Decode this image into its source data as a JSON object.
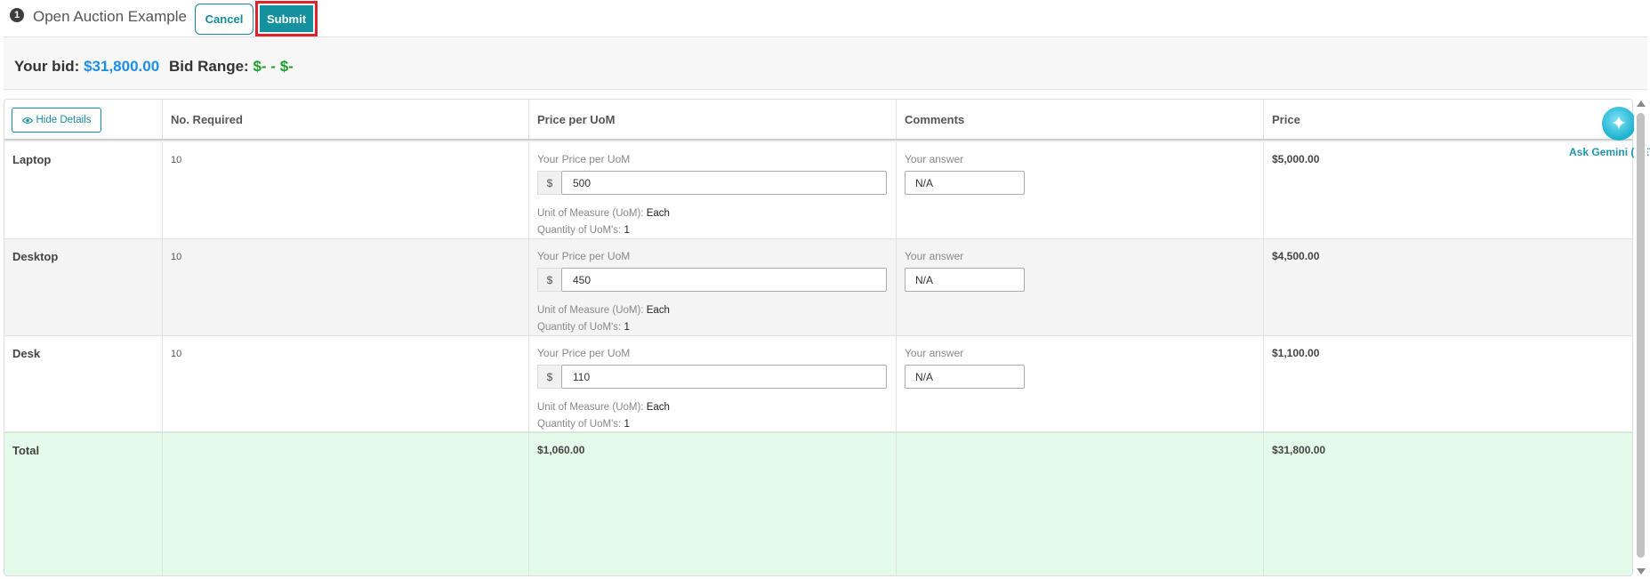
{
  "header": {
    "step_number": "1",
    "title": "Open Auction Example",
    "cancel_label": "Cancel",
    "submit_label": "Submit"
  },
  "bid_summary": {
    "your_bid_label": "Your bid:",
    "your_bid_value": "$31,800.00",
    "bid_range_label": "Bid Range:",
    "bid_range_value": "$- - $-"
  },
  "table": {
    "hide_details_label": "Hide Details",
    "columns": [
      "No. Required",
      "Price per UoM",
      "Comments",
      "Price"
    ],
    "rows": [
      {
        "name": "Laptop",
        "required": "10",
        "price_label": "Your Price per UoM",
        "currency": "$",
        "price_value": "500",
        "uom_label": "Unit of Measure (UoM):",
        "uom_value": "Each",
        "qty_label": "Quantity of UoM's:",
        "qty_value": "1",
        "comment_label": "Your answer",
        "comment_value": "N/A",
        "price": "$5,000.00"
      },
      {
        "name": "Desktop",
        "required": "10",
        "price_label": "Your Price per UoM",
        "currency": "$",
        "price_value": "450",
        "uom_label": "Unit of Measure (UoM):",
        "uom_value": "Each",
        "qty_label": "Quantity of UoM's:",
        "qty_value": "1",
        "comment_label": "Your answer",
        "comment_value": "N/A",
        "price": "$4,500.00"
      },
      {
        "name": "Desk",
        "required": "10",
        "price_label": "Your Price per UoM",
        "currency": "$",
        "price_value": "110",
        "uom_label": "Unit of Measure (UoM):",
        "uom_value": "Each",
        "qty_label": "Quantity of UoM's:",
        "qty_value": "1",
        "comment_label": "Your answer",
        "comment_value": "N/A",
        "price": "$1,100.00"
      }
    ],
    "total": {
      "label": "Total",
      "price_per_uom": "$1,060.00",
      "price": "$31,800.00"
    }
  },
  "assistant": {
    "label": "Ask Gemini (BET"
  },
  "colors": {
    "accent": "#14919f",
    "bid_value": "#1c8ee5",
    "range_value": "#1e9e2a",
    "highlight_border": "#e0202b",
    "alt_row": "#f4f4f4",
    "total_row": "#e5fbea"
  }
}
